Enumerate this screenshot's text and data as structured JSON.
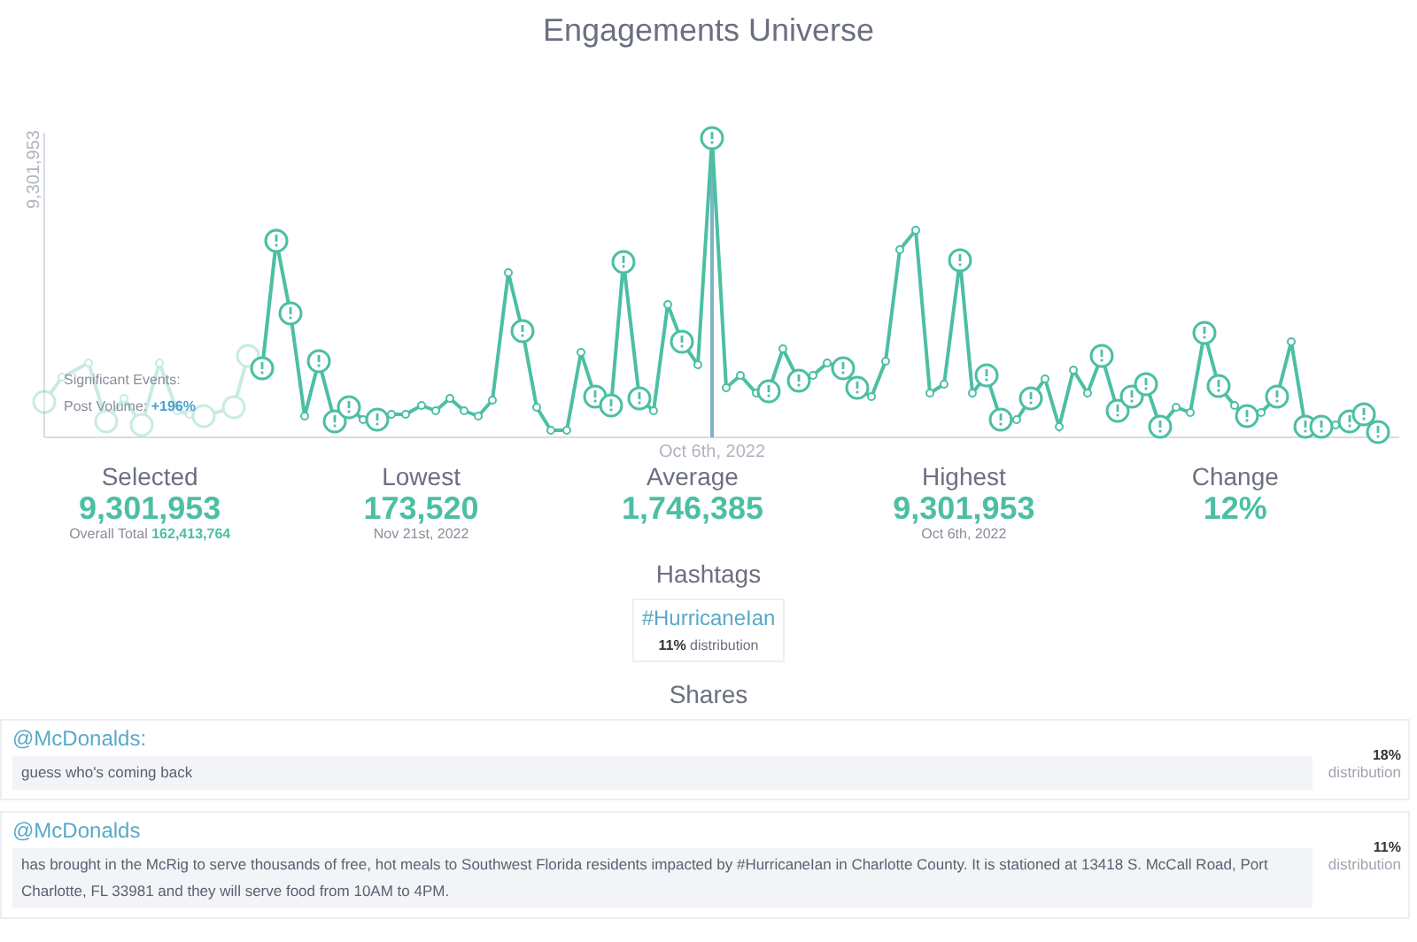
{
  "title": "Engagements Universe",
  "chart": {
    "y_label": "9,301,953",
    "x_label": "Oct 6th, 2022",
    "tooltip": {
      "title": "Significant Events:",
      "line": "Post Volume: **+196%**"
    }
  },
  "stats": [
    {
      "label": "Selected",
      "value": "9,301,953",
      "note": "Overall Total **162,413,764**"
    },
    {
      "label": "Lowest",
      "value": "173,520",
      "note": "Nov 21st, 2022"
    },
    {
      "label": "Average",
      "value": "1,746,385"
    },
    {
      "label": "Highest",
      "value": "9,301,953",
      "note": "Oct 6th, 2022"
    },
    {
      "label": "Change",
      "value": "12%"
    }
  ],
  "hashtags": {
    "heading": "Hashtags",
    "items": [
      {
        "tag": "#HurricaneIan",
        "distribution": "**11%** distribution"
      }
    ]
  },
  "shares": {
    "heading": "Shares",
    "items": [
      {
        "author": "@McDonalds:",
        "text": "guess who's coming back",
        "percent": "18%",
        "label": "distribution"
      },
      {
        "author": "@McDonalds",
        "text": "has brought in the McRig to serve thousands of free, hot meals to Southwest Florida residents impacted by #HurricaneIan in Charlotte County. It is stationed at 13418 S. McCall Road, Port Charlotte, FL 33981 and they will serve food from 10AM to 4PM.",
        "percent": "11%",
        "label": "distribution"
      }
    ]
  }
}
